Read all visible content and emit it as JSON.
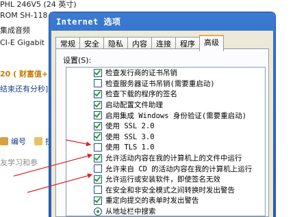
{
  "background": {
    "lines": [
      "PHL 246V5 (24 英寸)",
      "ROM SH-118",
      "集成音频",
      "CI-E Gigabit",
      "20 ( 财富值+",
      "结束还有分秒]",
      "编号",
      "技",
      "友学习和参"
    ]
  },
  "dialog": {
    "title": "Internet 选项",
    "tabs": [
      "常规",
      "安全",
      "隐私",
      "内容",
      "连接",
      "程序",
      "高级"
    ],
    "active_tab": "高级",
    "settings_label": "设置(S):",
    "items": [
      {
        "type": "checkbox",
        "checked": true,
        "label": "检查发行商的证书吊销"
      },
      {
        "type": "checkbox",
        "checked": false,
        "label": "检查服务器证书吊销(需要重启动)"
      },
      {
        "type": "checkbox",
        "checked": true,
        "label": "检查下载的程序的签名"
      },
      {
        "type": "checkbox",
        "checked": true,
        "label": "启动配置文件助理"
      },
      {
        "type": "checkbox",
        "checked": true,
        "label": "启用集成 Windows 身份验证(需要重启动)"
      },
      {
        "type": "checkbox",
        "checked": true,
        "label": "使用 SSL 2.0"
      },
      {
        "type": "checkbox",
        "checked": true,
        "label": "使用 SSL 3.0"
      },
      {
        "type": "checkbox",
        "checked": false,
        "label": "使用 TLS 1.0"
      },
      {
        "type": "checkbox",
        "checked": true,
        "label": "允许活动内容在我的计算机上的文件中运行"
      },
      {
        "type": "checkbox",
        "checked": false,
        "label": "允许来自 CD 的活动内容在我的计算机上运行"
      },
      {
        "type": "checkbox",
        "checked": true,
        "label": "允许运行或安装软件，即使签名无效"
      },
      {
        "type": "checkbox",
        "checked": false,
        "label": "在安全和非安全模式之间转换时发出警告"
      },
      {
        "type": "checkbox",
        "checked": true,
        "label": "重定向提交的表单时发出警告"
      },
      {
        "type": "radio",
        "selected": true,
        "label": "从地址栏中搜索"
      }
    ]
  },
  "colors": {
    "titlebar": "#2a5fb5",
    "arrow": "#e02020"
  }
}
